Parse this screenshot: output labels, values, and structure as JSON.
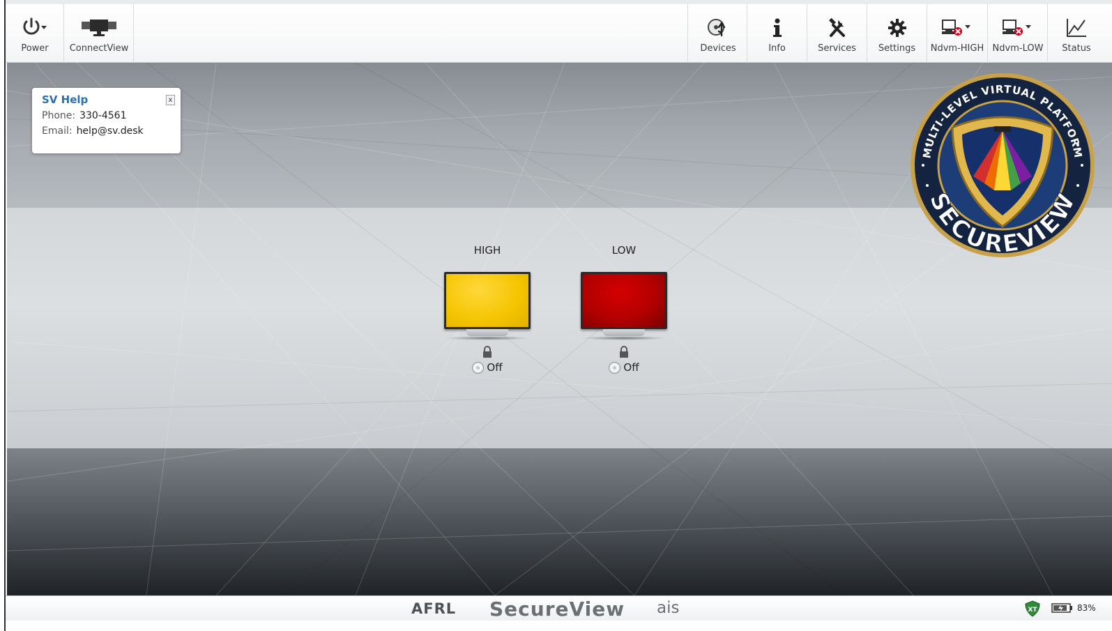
{
  "toolbar": {
    "left": [
      {
        "label": "Power",
        "icon": "power-icon"
      },
      {
        "label": "ConnectView",
        "icon": "monitors-icon"
      }
    ],
    "right": [
      {
        "label": "Devices",
        "icon": "devices-icon"
      },
      {
        "label": "Info",
        "icon": "info-icon"
      },
      {
        "label": "Services",
        "icon": "tools-icon"
      },
      {
        "label": "Settings",
        "icon": "gear-icon"
      },
      {
        "label": "Ndvm-HIGH",
        "icon": "network-disconnected-icon"
      },
      {
        "label": "Ndvm-LOW",
        "icon": "network-disconnected-icon"
      },
      {
        "label": "Status",
        "icon": "chart-icon"
      }
    ]
  },
  "help": {
    "title": "SV Help",
    "phone_label": "Phone:",
    "phone": "330-4561",
    "email_label": "Email:",
    "email": "help@sv.desk",
    "close": "x"
  },
  "vms": [
    {
      "name": "HIGH",
      "screen_color": "#f4c400",
      "state": "Off"
    },
    {
      "name": "LOW",
      "screen_color": "#b30000",
      "state": "Off"
    }
  ],
  "emblem": {
    "top_text": "MULTI-LEVEL VIRTUAL PLATFORM",
    "bottom_text": "SECUREVIEW"
  },
  "statusbar": {
    "afrl": "AFRL",
    "product": "SecureView",
    "ais": "ais",
    "shield_label": "XT",
    "battery": "83%"
  },
  "colors": {
    "help_title": "#2a6fb0",
    "high_screen": "#f4c400",
    "low_screen": "#b30000",
    "emblem_ring": "#c8a24a"
  }
}
